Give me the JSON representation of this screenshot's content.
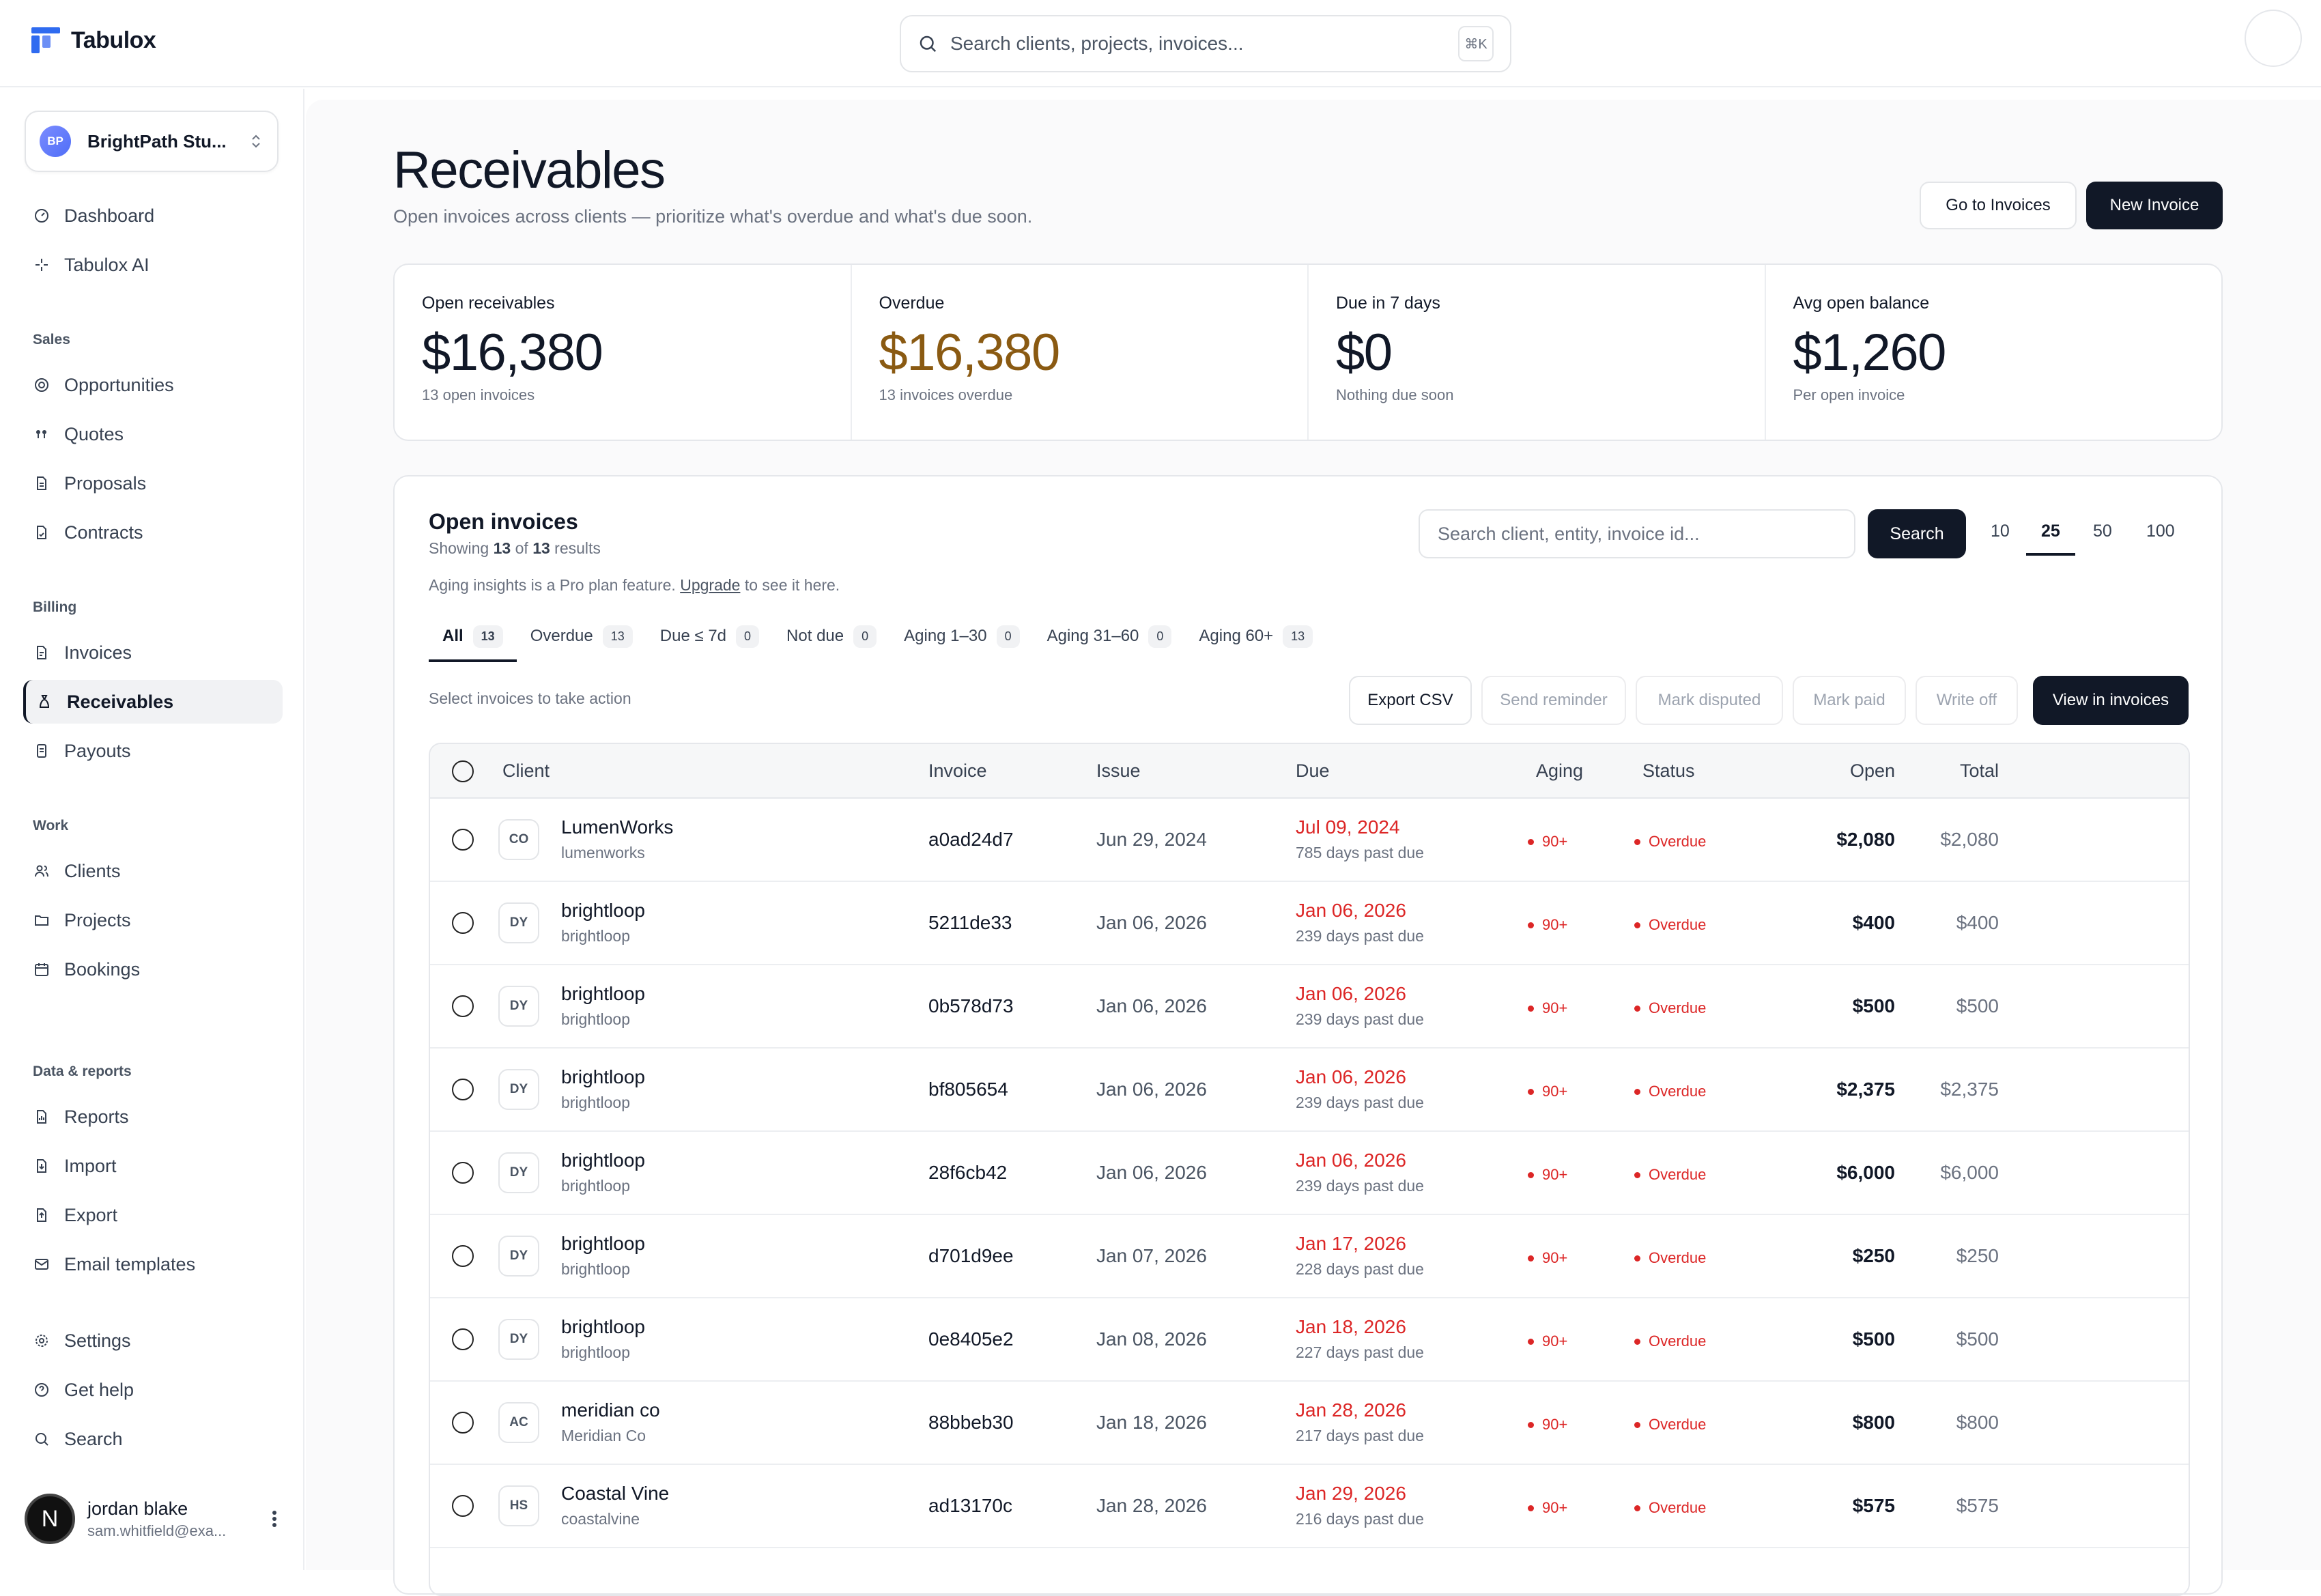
{
  "app": {
    "name": "Tabulox"
  },
  "global_search": {
    "placeholder": "Search clients, projects, invoices...",
    "shortcut": "⌘K"
  },
  "workspace": {
    "initials": "BP",
    "name": "BrightPath Stu..."
  },
  "nav": {
    "top": [
      {
        "label": "Dashboard",
        "icon": "dashboard-icon"
      },
      {
        "label": "Tabulox AI",
        "icon": "sparkle-icon"
      }
    ],
    "sections": [
      {
        "title": "Sales",
        "items": [
          {
            "label": "Opportunities"
          },
          {
            "label": "Quotes"
          },
          {
            "label": "Proposals"
          },
          {
            "label": "Contracts"
          }
        ]
      },
      {
        "title": "Billing",
        "items": [
          {
            "label": "Invoices"
          },
          {
            "label": "Receivables"
          },
          {
            "label": "Payouts"
          }
        ]
      },
      {
        "title": "Work",
        "items": [
          {
            "label": "Clients"
          },
          {
            "label": "Projects"
          },
          {
            "label": "Bookings"
          }
        ]
      },
      {
        "title": "Data & reports",
        "items": [
          {
            "label": "Reports"
          },
          {
            "label": "Import"
          },
          {
            "label": "Export"
          },
          {
            "label": "Email templates"
          }
        ]
      }
    ],
    "bottom": [
      {
        "label": "Settings"
      },
      {
        "label": "Get help"
      },
      {
        "label": "Search"
      }
    ],
    "active": "Receivables"
  },
  "user": {
    "avatar_letter": "N",
    "name": "jordan blake",
    "email": "sam.whitfield@exa..."
  },
  "page": {
    "title": "Receivables",
    "subtitle": "Open invoices across clients — prioritize what's overdue and what's due soon.",
    "go_to_invoices": "Go to Invoices",
    "new_invoice": "New Invoice"
  },
  "stats": [
    {
      "label": "Open receivables",
      "value": "$16,380",
      "sub": "13 open invoices",
      "color": "#111827"
    },
    {
      "label": "Overdue",
      "value": "$16,380",
      "sub": "13 invoices overdue",
      "color": "#8a5a12"
    },
    {
      "label": "Due in 7 days",
      "value": "$0",
      "sub": "Nothing due soon",
      "color": "#111827"
    },
    {
      "label": "Avg open balance",
      "value": "$1,260",
      "sub": "Per open invoice",
      "color": "#111827"
    }
  ],
  "open_invoices": {
    "title": "Open invoices",
    "showing_prefix": "Showing ",
    "showing_count": "13",
    "showing_mid": " of ",
    "showing_total": "13",
    "showing_suffix": " results",
    "note_prefix": "Aging insights is a Pro plan feature. ",
    "note_link": "Upgrade",
    "note_suffix": " to see it here.",
    "search_placeholder": "Search client, entity, invoice id...",
    "search_button": "Search",
    "page_sizes": [
      "10",
      "25",
      "50",
      "100"
    ],
    "page_size_active": "25",
    "tabs": [
      {
        "label": "All",
        "count": "13"
      },
      {
        "label": "Overdue",
        "count": "13"
      },
      {
        "label": "Due ≤ 7d",
        "count": "0"
      },
      {
        "label": "Not due",
        "count": "0"
      },
      {
        "label": "Aging 1–30",
        "count": "0"
      },
      {
        "label": "Aging 31–60",
        "count": "0"
      },
      {
        "label": "Aging 60+",
        "count": "13"
      }
    ],
    "select_hint": "Select invoices to take action",
    "actions": {
      "export_csv": "Export CSV",
      "send_reminder": "Send reminder",
      "mark_disputed": "Mark disputed",
      "mark_paid": "Mark paid",
      "write_off": "Write off",
      "view_in_invoices": "View in invoices"
    },
    "columns": {
      "client": "Client",
      "invoice": "Invoice",
      "issue": "Issue",
      "due": "Due",
      "aging": "Aging",
      "status": "Status",
      "open": "Open",
      "total": "Total"
    },
    "rows": [
      {
        "initials": "CO",
        "client": "LumenWorks",
        "entity": "lumenworks",
        "invoice": "a0ad24d7",
        "issue": "Jun 29, 2024",
        "due": "Jul 09, 2024",
        "past_due": "785 days past due",
        "aging": "90+",
        "status": "Overdue",
        "open": "$2,080",
        "total": "$2,080"
      },
      {
        "initials": "DY",
        "client": "brightloop",
        "entity": "brightloop",
        "invoice": "5211de33",
        "issue": "Jan 06, 2026",
        "due": "Jan 06, 2026",
        "past_due": "239 days past due",
        "aging": "90+",
        "status": "Overdue",
        "open": "$400",
        "total": "$400"
      },
      {
        "initials": "DY",
        "client": "brightloop",
        "entity": "brightloop",
        "invoice": "0b578d73",
        "issue": "Jan 06, 2026",
        "due": "Jan 06, 2026",
        "past_due": "239 days past due",
        "aging": "90+",
        "status": "Overdue",
        "open": "$500",
        "total": "$500"
      },
      {
        "initials": "DY",
        "client": "brightloop",
        "entity": "brightloop",
        "invoice": "bf805654",
        "issue": "Jan 06, 2026",
        "due": "Jan 06, 2026",
        "past_due": "239 days past due",
        "aging": "90+",
        "status": "Overdue",
        "open": "$2,375",
        "total": "$2,375"
      },
      {
        "initials": "DY",
        "client": "brightloop",
        "entity": "brightloop",
        "invoice": "28f6cb42",
        "issue": "Jan 06, 2026",
        "due": "Jan 06, 2026",
        "past_due": "239 days past due",
        "aging": "90+",
        "status": "Overdue",
        "open": "$6,000",
        "total": "$6,000"
      },
      {
        "initials": "DY",
        "client": "brightloop",
        "entity": "brightloop",
        "invoice": "d701d9ee",
        "issue": "Jan 07, 2026",
        "due": "Jan 17, 2026",
        "past_due": "228 days past due",
        "aging": "90+",
        "status": "Overdue",
        "open": "$250",
        "total": "$250"
      },
      {
        "initials": "DY",
        "client": "brightloop",
        "entity": "brightloop",
        "invoice": "0e8405e2",
        "issue": "Jan 08, 2026",
        "due": "Jan 18, 2026",
        "past_due": "227 days past due",
        "aging": "90+",
        "status": "Overdue",
        "open": "$500",
        "total": "$500"
      },
      {
        "initials": "AC",
        "client": "meridian co",
        "entity": "Meridian Co",
        "invoice": "88bbeb30",
        "issue": "Jan 18, 2026",
        "due": "Jan 28, 2026",
        "past_due": "217 days past due",
        "aging": "90+",
        "status": "Overdue",
        "open": "$800",
        "total": "$800"
      },
      {
        "initials": "HS",
        "client": "Coastal Vine",
        "entity": "coastalvine",
        "invoice": "ad13170c",
        "issue": "Jan 28, 2026",
        "due": "Jan 29, 2026",
        "past_due": "216 days past due",
        "aging": "90+",
        "status": "Overdue",
        "open": "$575",
        "total": "$575"
      }
    ]
  }
}
